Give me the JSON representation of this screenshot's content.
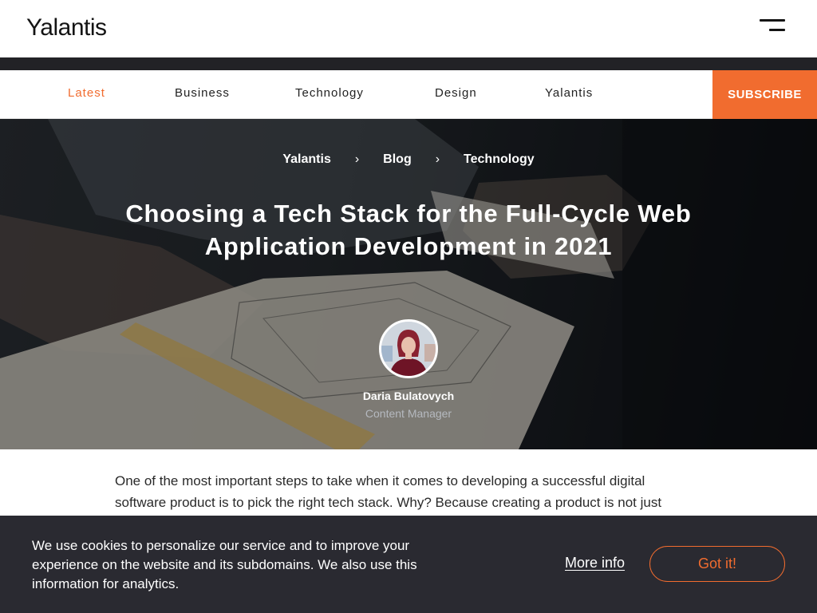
{
  "header": {
    "logo": "Yalantis",
    "menu_icon": "hamburger-menu-icon"
  },
  "nav": {
    "items": [
      {
        "label": "Latest",
        "active": true
      },
      {
        "label": "Business",
        "active": false
      },
      {
        "label": "Technology",
        "active": false
      },
      {
        "label": "Design",
        "active": false
      },
      {
        "label": "Yalantis",
        "active": false
      }
    ],
    "subscribe_label": "SUBSCRIBE"
  },
  "hero": {
    "breadcrumb": [
      "Yalantis",
      "Blog",
      "Technology"
    ],
    "breadcrumb_separator": "›",
    "title": "Choosing a Tech Stack for the Full-Cycle Web Application Development in 2021",
    "author": {
      "name": "Daria Bulatovych",
      "role": "Content Manager"
    }
  },
  "article": {
    "intro": "One of the most important steps to take when it comes to developing a successful digital software product is to pick the right tech stack. Why? Because creating a product is not just"
  },
  "cookie_banner": {
    "text": "We use cookies to personalize our service and to improve your experience on the website and its subdomains. We also use this information for analytics.",
    "more_info_label": "More info",
    "accept_label": "Got it!"
  },
  "colors": {
    "accent": "#f16c2f",
    "banner_bg": "#2a2a31",
    "dark_strip": "#222226"
  }
}
